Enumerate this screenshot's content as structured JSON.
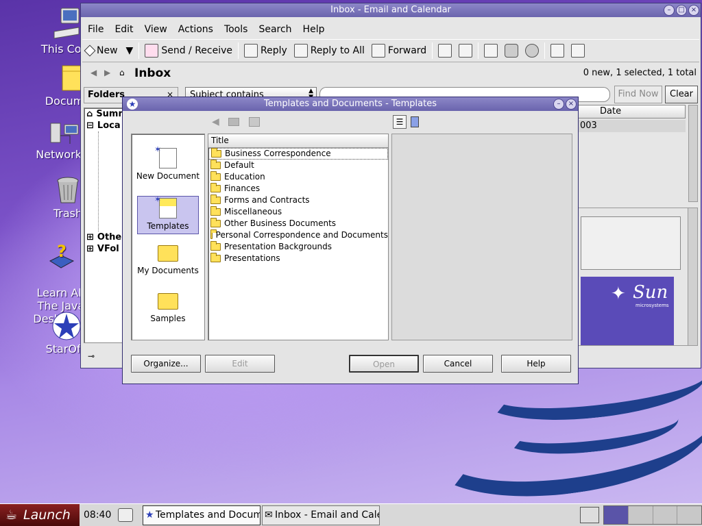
{
  "desktop": {
    "icons": [
      {
        "label": "This Com",
        "icon": "computer-icon"
      },
      {
        "label": "Docume",
        "icon": "folder-icon"
      },
      {
        "label": "Network P",
        "icon": "network-icon"
      },
      {
        "label": "Trash",
        "icon": "trash-icon"
      },
      {
        "label": "Learn Ab\nThe Java\nDesktop S",
        "icon": "help-icon"
      },
      {
        "label": "StarOffi",
        "icon": "staroffice-icon"
      }
    ]
  },
  "mail": {
    "title": "Inbox - Email and Calendar",
    "menu": [
      "File",
      "Edit",
      "View",
      "Actions",
      "Tools",
      "Search",
      "Help"
    ],
    "toolbar": {
      "new": "New",
      "send_receive": "Send / Receive",
      "reply": "Reply",
      "reply_all": "Reply to All",
      "forward": "Forward"
    },
    "folder_title": "Inbox",
    "status": "0 new, 1 selected, 1 total",
    "folders_label": "Folders",
    "search_option": "Subject contains",
    "find_now": "Find Now",
    "clear": "Clear",
    "col_date": "Date",
    "row_date": "003",
    "tree": [
      "Summ",
      "Loca",
      "Othe",
      "VFol"
    ]
  },
  "dialog": {
    "title": "Templates and Documents - Templates",
    "nav": [
      {
        "label": "New Document",
        "icon": "new-document-icon"
      },
      {
        "label": "Templates",
        "icon": "templates-icon",
        "selected": true
      },
      {
        "label": "My Documents",
        "icon": "my-documents-icon"
      },
      {
        "label": "Samples",
        "icon": "samples-icon"
      }
    ],
    "list_header": "Title",
    "items": [
      "Business Correspondence",
      "Default",
      "Education",
      "Finances",
      "Forms and Contracts",
      "Miscellaneous",
      "Other Business Documents",
      "Personal Correspondence and Documents",
      "Presentation Backgrounds",
      "Presentations"
    ],
    "buttons": {
      "organize": "Organize...",
      "edit": "Edit",
      "open": "Open",
      "cancel": "Cancel",
      "help": "Help"
    }
  },
  "preview": {
    "logo_text": "Sun",
    "logo_sub": "microsystems"
  },
  "taskbar": {
    "launch": "Launch",
    "time": "08:40",
    "tasks": [
      "Templates and Docume",
      "Inbox - Email and Calen"
    ]
  },
  "colors": {
    "titlebar": "#6a64ad",
    "selection": "#c9c5ef",
    "sun_purple": "#5a4bb8"
  }
}
